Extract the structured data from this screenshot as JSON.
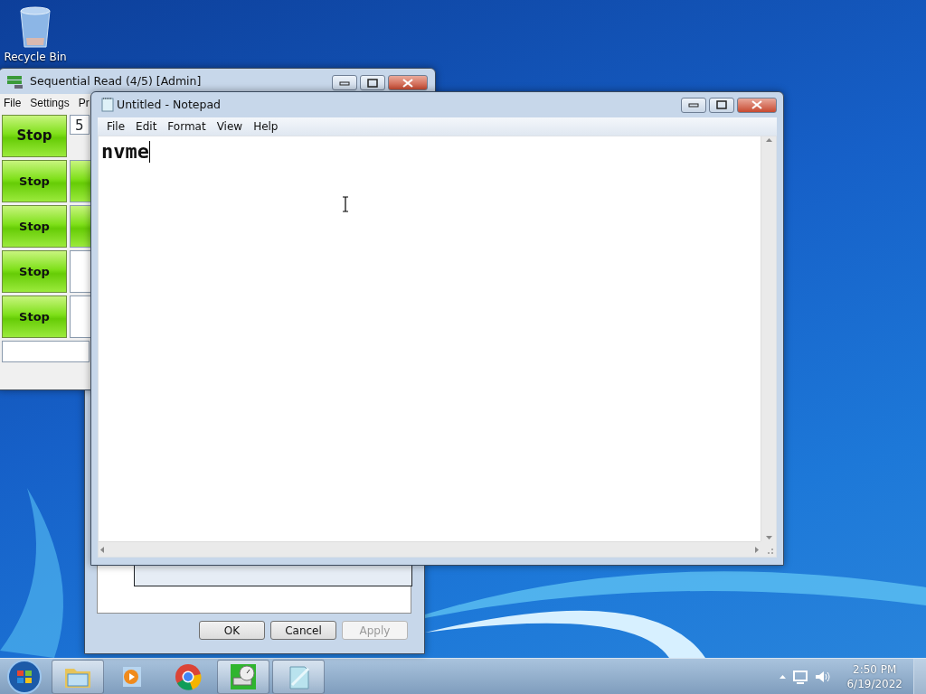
{
  "desktop_icons": [
    {
      "label": "Recycle Bin"
    }
  ],
  "properties_dialog": {
    "buttons": [
      {
        "label": "OK",
        "disabled": false
      },
      {
        "label": "Cancel",
        "disabled": false
      },
      {
        "label": "Apply",
        "disabled": true
      }
    ]
  },
  "benchmark_window": {
    "title": "Sequential Read (4/5) [Admin]",
    "menu": [
      "File",
      "Settings",
      "Pr"
    ],
    "rows": [
      {
        "button": "Stop",
        "emphasis": true,
        "cell": {
          "kind": "field",
          "value": "5"
        }
      },
      {
        "button": "Stop",
        "emphasis": false,
        "cell": {
          "kind": "meter"
        }
      },
      {
        "button": "Stop",
        "emphasis": false,
        "cell": {
          "kind": "meter"
        }
      },
      {
        "button": "Stop",
        "emphasis": false,
        "cell": {
          "kind": "blank"
        }
      },
      {
        "button": "Stop",
        "emphasis": false,
        "cell": {
          "kind": "blank"
        }
      }
    ]
  },
  "notepad": {
    "title": "Untitled - Notepad",
    "menu": [
      "File",
      "Edit",
      "Format",
      "View",
      "Help"
    ],
    "text": "nvme"
  },
  "taskbar": {
    "apps": [
      {
        "kind": "folder",
        "running": true
      },
      {
        "kind": "media",
        "running": false
      },
      {
        "kind": "browser",
        "running": false
      },
      {
        "kind": "disk",
        "running": true
      },
      {
        "kind": "notepad",
        "running": true
      }
    ],
    "clock": {
      "time": "2:50 PM",
      "date": "6/19/2022"
    }
  }
}
